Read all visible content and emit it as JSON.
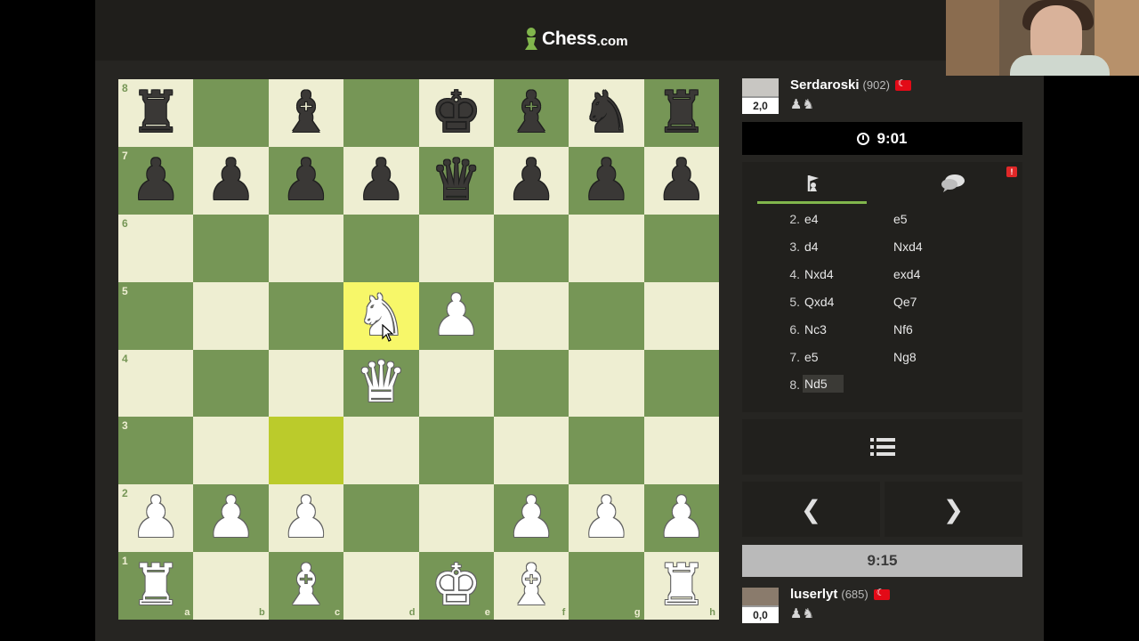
{
  "app": {
    "logo_name": "Chess",
    "logo_tld": ".com"
  },
  "board": {
    "files": [
      "a",
      "b",
      "c",
      "d",
      "e",
      "f",
      "g",
      "h"
    ],
    "ranks": [
      "8",
      "7",
      "6",
      "5",
      "4",
      "3",
      "2",
      "1"
    ],
    "highlight_from": "c3",
    "highlight_to": "d5",
    "pieces": {
      "a8": "bR",
      "c8": "bB",
      "e8": "bK",
      "f8": "bB",
      "g8": "bN",
      "h8": "bR",
      "a7": "bP",
      "b7": "bP",
      "c7": "bP",
      "d7": "bP",
      "e7": "bQ",
      "f7": "bP",
      "g7": "bP",
      "h7": "bP",
      "d5": "wN",
      "e5": "wP",
      "d4": "wQ",
      "a2": "wP",
      "b2": "wP",
      "c2": "wP",
      "f2": "wP",
      "g2": "wP",
      "h2": "wP",
      "a1": "wR",
      "c1": "wB",
      "e1": "wK",
      "f1": "wB",
      "h1": "wR"
    }
  },
  "opponent": {
    "name": "Serdaroski",
    "rating": "(902)",
    "score": "2,0",
    "captured": "♟♞",
    "clock": "9:01"
  },
  "player": {
    "name": "luserlyt",
    "rating": "(685)",
    "score": "0,0",
    "captured": "♟♞",
    "clock": "9:15"
  },
  "tabs": {
    "moves_icon": "pawn-flag-icon",
    "chat_icon": "chat-icon",
    "chat_badge": "!"
  },
  "moves": [
    {
      "num": "2.",
      "white": "e4",
      "black": "e5"
    },
    {
      "num": "3.",
      "white": "d4",
      "black": "Nxd4"
    },
    {
      "num": "4.",
      "white": "Nxd4",
      "black": "exd4"
    },
    {
      "num": "5.",
      "white": "Qxd4",
      "black": "Qe7"
    },
    {
      "num": "6.",
      "white": "Nc3",
      "black": "Nf6"
    },
    {
      "num": "7.",
      "white": "e5",
      "black": "Ng8"
    },
    {
      "num": "8.",
      "white": "Nd5",
      "black": ""
    }
  ],
  "colors": {
    "light_square": "#eeeed2",
    "dark_square": "#769656",
    "accent": "#81b64c"
  }
}
